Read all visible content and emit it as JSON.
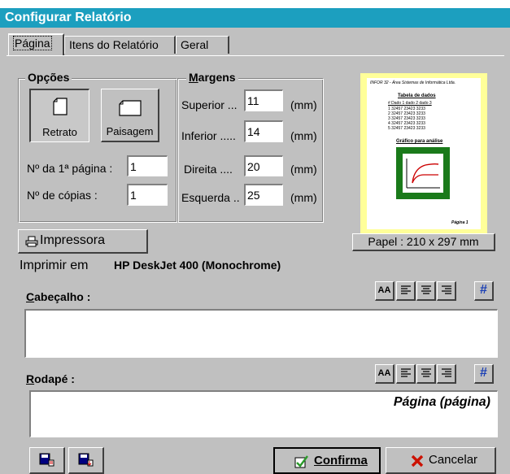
{
  "window": {
    "title": "Configurar Relatório"
  },
  "tabs": [
    {
      "label": "Página"
    },
    {
      "label": "Itens do Relatório"
    },
    {
      "label": "Geral"
    }
  ],
  "opcoes": {
    "title": "Opções",
    "retrato_label": "Retrato",
    "paisagem_label": "Paisagem",
    "primeira_pagina_label": "Nº da 1ª página :",
    "primeira_pagina_value": "1",
    "copias_label": "Nº de cópias :",
    "copias_value": "1"
  },
  "margens": {
    "title": "Margens",
    "unit": "(mm)",
    "rows": [
      {
        "label": "Superior ...",
        "value": "11"
      },
      {
        "label": "Inferior .....",
        "value": "14"
      },
      {
        "label": "Direita ....",
        "value": "20"
      },
      {
        "label": "Esquerda ..",
        "value": "25"
      }
    ]
  },
  "preview": {
    "header": "INFOR 32 - Área Sistemas de Informática Ltda.",
    "table_title": "Tabela de dados",
    "table_header": "#   Dado 1   dado 2   dado 3",
    "table_rows": [
      "1  32457   23423   3233",
      "2  32457   23423   3233",
      "3  32457   23423   3233",
      "4  32457   23423   3233",
      "5  32457   23423   3233"
    ],
    "chart_title": "Gráfico para análise",
    "footer": "Página 1"
  },
  "paper": {
    "label": "Papel : 210 x 297 mm"
  },
  "printer": {
    "button_label": "Impressora",
    "prefix": "Imprimir em",
    "name": "HP DeskJet 400 (Monochrome)"
  },
  "cabecalho": {
    "label": "Cabeçalho  :",
    "text": ""
  },
  "rodape": {
    "label": "Rodapé  :",
    "text": "Página (página)"
  },
  "toolbar": {
    "font_label": "AA",
    "hash_label": "#"
  },
  "footer": {
    "confirma_label": "Confirma",
    "cancelar_label": "Cancelar"
  },
  "colors": {
    "title_bar": "#1c9fbf",
    "paper_preview": "#ffff99",
    "chart_frame": "#1a7a1a"
  }
}
